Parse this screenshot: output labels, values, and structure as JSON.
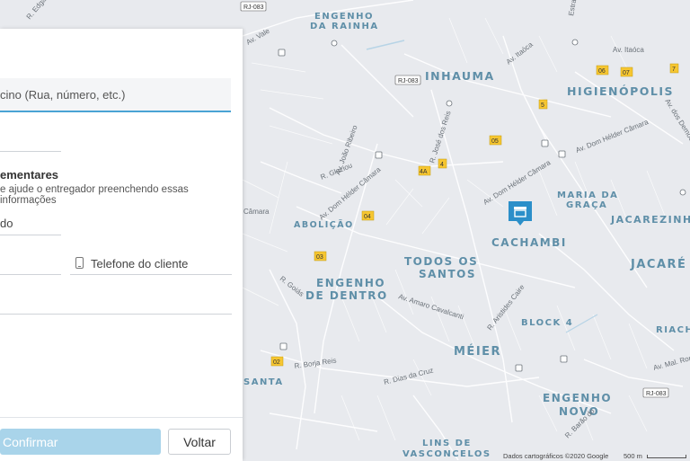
{
  "map": {
    "neighborhoods": [
      {
        "id": "engenho-rainha-1",
        "text": "ENGENHO"
      },
      {
        "id": "engenho-rainha-2",
        "text": "DA RAINHA"
      },
      {
        "id": "inhauma",
        "text": "INHAUMA"
      },
      {
        "id": "higienopolis",
        "text": "HIGIENÓPOLIS"
      },
      {
        "id": "maria-graca-1",
        "text": "MARIA DA"
      },
      {
        "id": "maria-graca-2",
        "text": "GRAÇA"
      },
      {
        "id": "jacarezinho",
        "text": "JACAREZINHO"
      },
      {
        "id": "abolicao",
        "text": "ABOLIÇÃO"
      },
      {
        "id": "cachambi",
        "text": "CACHAMBI"
      },
      {
        "id": "todos-santos-1",
        "text": "TODOS OS"
      },
      {
        "id": "todos-santos-2",
        "text": "SANTOS"
      },
      {
        "id": "jacare",
        "text": "JACARÉ"
      },
      {
        "id": "engenho-dentro-1",
        "text": "ENGENHO"
      },
      {
        "id": "engenho-dentro-2",
        "text": "DE DENTRO"
      },
      {
        "id": "block4",
        "text": "BLOCK 4"
      },
      {
        "id": "riachuelo",
        "text": "RIACHU"
      },
      {
        "id": "meier",
        "text": "MÉIER"
      },
      {
        "id": "santa",
        "text": "SANTA"
      },
      {
        "id": "engenho-novo-1",
        "text": "ENGENHO"
      },
      {
        "id": "engenho-novo-2",
        "text": "NOVO"
      },
      {
        "id": "lins-1",
        "text": "LINS DE"
      },
      {
        "id": "lins-2",
        "text": "VASCONCELOS"
      }
    ],
    "streets": [
      {
        "id": "edgard",
        "text": "R. Edgard R"
      },
      {
        "id": "vale",
        "text": "Av. Vale"
      },
      {
        "id": "itaoca1",
        "text": "Av. Itaóca"
      },
      {
        "id": "itaoca2",
        "text": "Av. Itaóca"
      },
      {
        "id": "joao-ribeiro",
        "text": "Av. João Ribeiro"
      },
      {
        "id": "jose-reis",
        "text": "R. José dos Reis"
      },
      {
        "id": "glaziou",
        "text": "R. Glaziou"
      },
      {
        "id": "helder1",
        "text": "Av. Dom Hélder Câmara"
      },
      {
        "id": "helder2",
        "text": "Av. Dom Hélder Câmara"
      },
      {
        "id": "helder3",
        "text": "Av. Dom Hélder Câmara"
      },
      {
        "id": "camara",
        "text": "Câmara"
      },
      {
        "id": "goias",
        "text": "R. Goiás"
      },
      {
        "id": "amaro",
        "text": "Av. Amaro Cavalcanti"
      },
      {
        "id": "aristides",
        "text": "R. Aristides Caire"
      },
      {
        "id": "borja",
        "text": "R. Borja Reis"
      },
      {
        "id": "dias-cruz",
        "text": "R. Dias da Cruz"
      },
      {
        "id": "mal-rond",
        "text": "Av. Mal. Ron"
      },
      {
        "id": "barao",
        "text": "R. Barão do"
      },
      {
        "id": "democr",
        "text": "Av. dos Democr"
      },
      {
        "id": "estra",
        "text": "Estra"
      }
    ],
    "shields": [
      {
        "id": "rj083a",
        "text": "RJ-083"
      },
      {
        "id": "rj083b",
        "text": "RJ-083"
      },
      {
        "id": "rj083c",
        "text": "RJ-083"
      }
    ],
    "markers": [
      {
        "id": "m06",
        "text": "06"
      },
      {
        "id": "m07",
        "text": "07"
      },
      {
        "id": "m7",
        "text": "7"
      },
      {
        "id": "m5",
        "text": "5"
      },
      {
        "id": "m05",
        "text": "05"
      },
      {
        "id": "m4",
        "text": "4"
      },
      {
        "id": "m4a",
        "text": "4A"
      },
      {
        "id": "m04",
        "text": "04"
      },
      {
        "id": "m03",
        "text": "03"
      },
      {
        "id": "m02",
        "text": "02"
      }
    ],
    "attribution": "Dados cartográficos ©2020 Google",
    "scale": "500 m"
  },
  "form": {
    "address_placeholder": "cino (Rua, número, etc.)",
    "section_title": "ementares",
    "section_desc": "e ajude o entregador preenchendo essas informações",
    "complement": "do",
    "phone_label": "Telefone do cliente",
    "confirm_label": "Confirmar",
    "back_label": "Voltar"
  },
  "colors": {
    "accent": "#4aa3d4",
    "confirm_disabled": "#a9d4ea",
    "pin": "#2b8fc9"
  }
}
